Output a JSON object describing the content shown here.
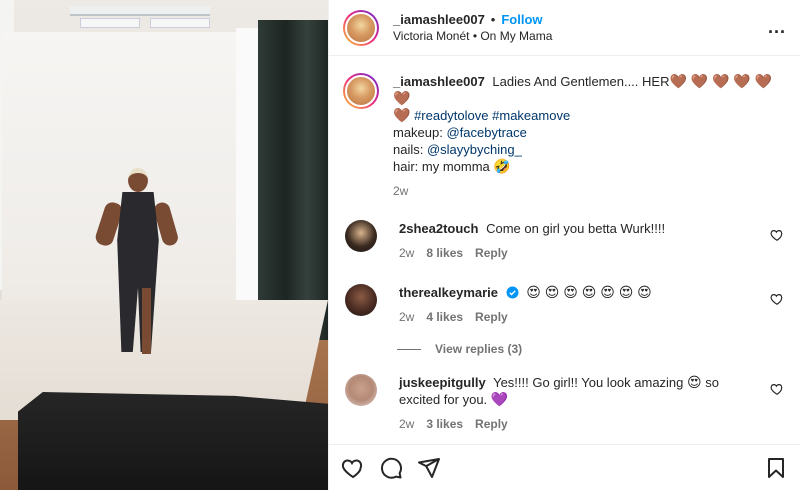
{
  "post": {
    "username": "_iamashlee007",
    "separator": "•",
    "follow_label": "Follow",
    "music": "Victoria Monét • On My Mama",
    "more_label": "..."
  },
  "caption": {
    "username": "_iamashlee007",
    "text": "Ladies And Gentlemen.... HER",
    "hearts_line1": "🤎 🤎 🤎 🤎 🤎 🤎",
    "heart_line2": "🤎",
    "hashtag1": "#readytolove",
    "hashtag2": "#makeamove",
    "makeup_label": "makeup: ",
    "makeup_tag": "@facebytrace",
    "nails_label": "nails: ",
    "nails_tag": "@slayybyching_",
    "hair_text": "hair: my momma",
    "hair_emoji": "🤣",
    "time": "2w"
  },
  "comments": [
    {
      "username": "2shea2touch",
      "text": "Come on girl you betta Wurk!!!!",
      "time": "2w",
      "likes": "8 likes",
      "reply": "Reply"
    },
    {
      "username": "therealkeymarie",
      "emojis": "😍 😍 😍 😍 😍 😍 😍",
      "time": "2w",
      "likes": "4 likes",
      "reply": "Reply",
      "view_replies": "View replies (3)"
    },
    {
      "username": "juskeepitgully",
      "text_before": "Yes!!!! Go girl!! You look amazing",
      "emoji1": "😍",
      "text_after": "so excited for you.",
      "emoji2": "💜",
      "time": "2w",
      "likes": "3 likes",
      "reply": "Reply"
    }
  ],
  "icons": {
    "like": "heart-icon",
    "comment": "comment-icon",
    "share": "share-icon",
    "save": "bookmark-icon"
  },
  "colors": {
    "accent": "#0095f6",
    "tag": "#00376b",
    "muted": "#737373"
  }
}
